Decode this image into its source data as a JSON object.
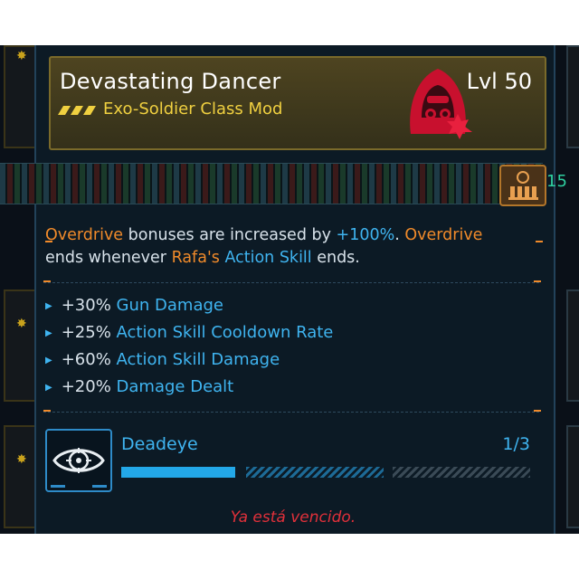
{
  "item": {
    "name": "Devastating Dancer",
    "level": "Lvl 50",
    "type": "Exo-Soldier Class Mod",
    "rarity_icon": "rarity-chevrons-icon",
    "mod_icon": "hooded-soldier-icon"
  },
  "manufacturer": {
    "badge_icon": "ammo-manufacturer-icon",
    "side_value": "15"
  },
  "description": {
    "part1": "Overdrive",
    "part2": " bonuses are increased by ",
    "part3": "+100%",
    "part4": ". ",
    "part5": "Overdrive",
    "part6": "ends whenever ",
    "part7": "Rafa's",
    "part8": " ",
    "part9": "Action Skill",
    "part10": " ends."
  },
  "stats": [
    {
      "value": "+30%",
      "name": "Gun Damage"
    },
    {
      "value": "+25%",
      "name": "Action Skill Cooldown Rate"
    },
    {
      "value": "+60%",
      "name": "Action Skill Damage"
    },
    {
      "value": "+20%",
      "name": "Damage Dealt"
    }
  ],
  "skill": {
    "name": "Deadeye",
    "count": "1/3",
    "progress_fraction": 0.333
  },
  "footer": "Ya está vencido.",
  "colors": {
    "accent_orange": "#f08a2a",
    "accent_blue": "#3fb4f0",
    "legendary_gold": "#f0d040",
    "warning_red": "#e0303a"
  }
}
